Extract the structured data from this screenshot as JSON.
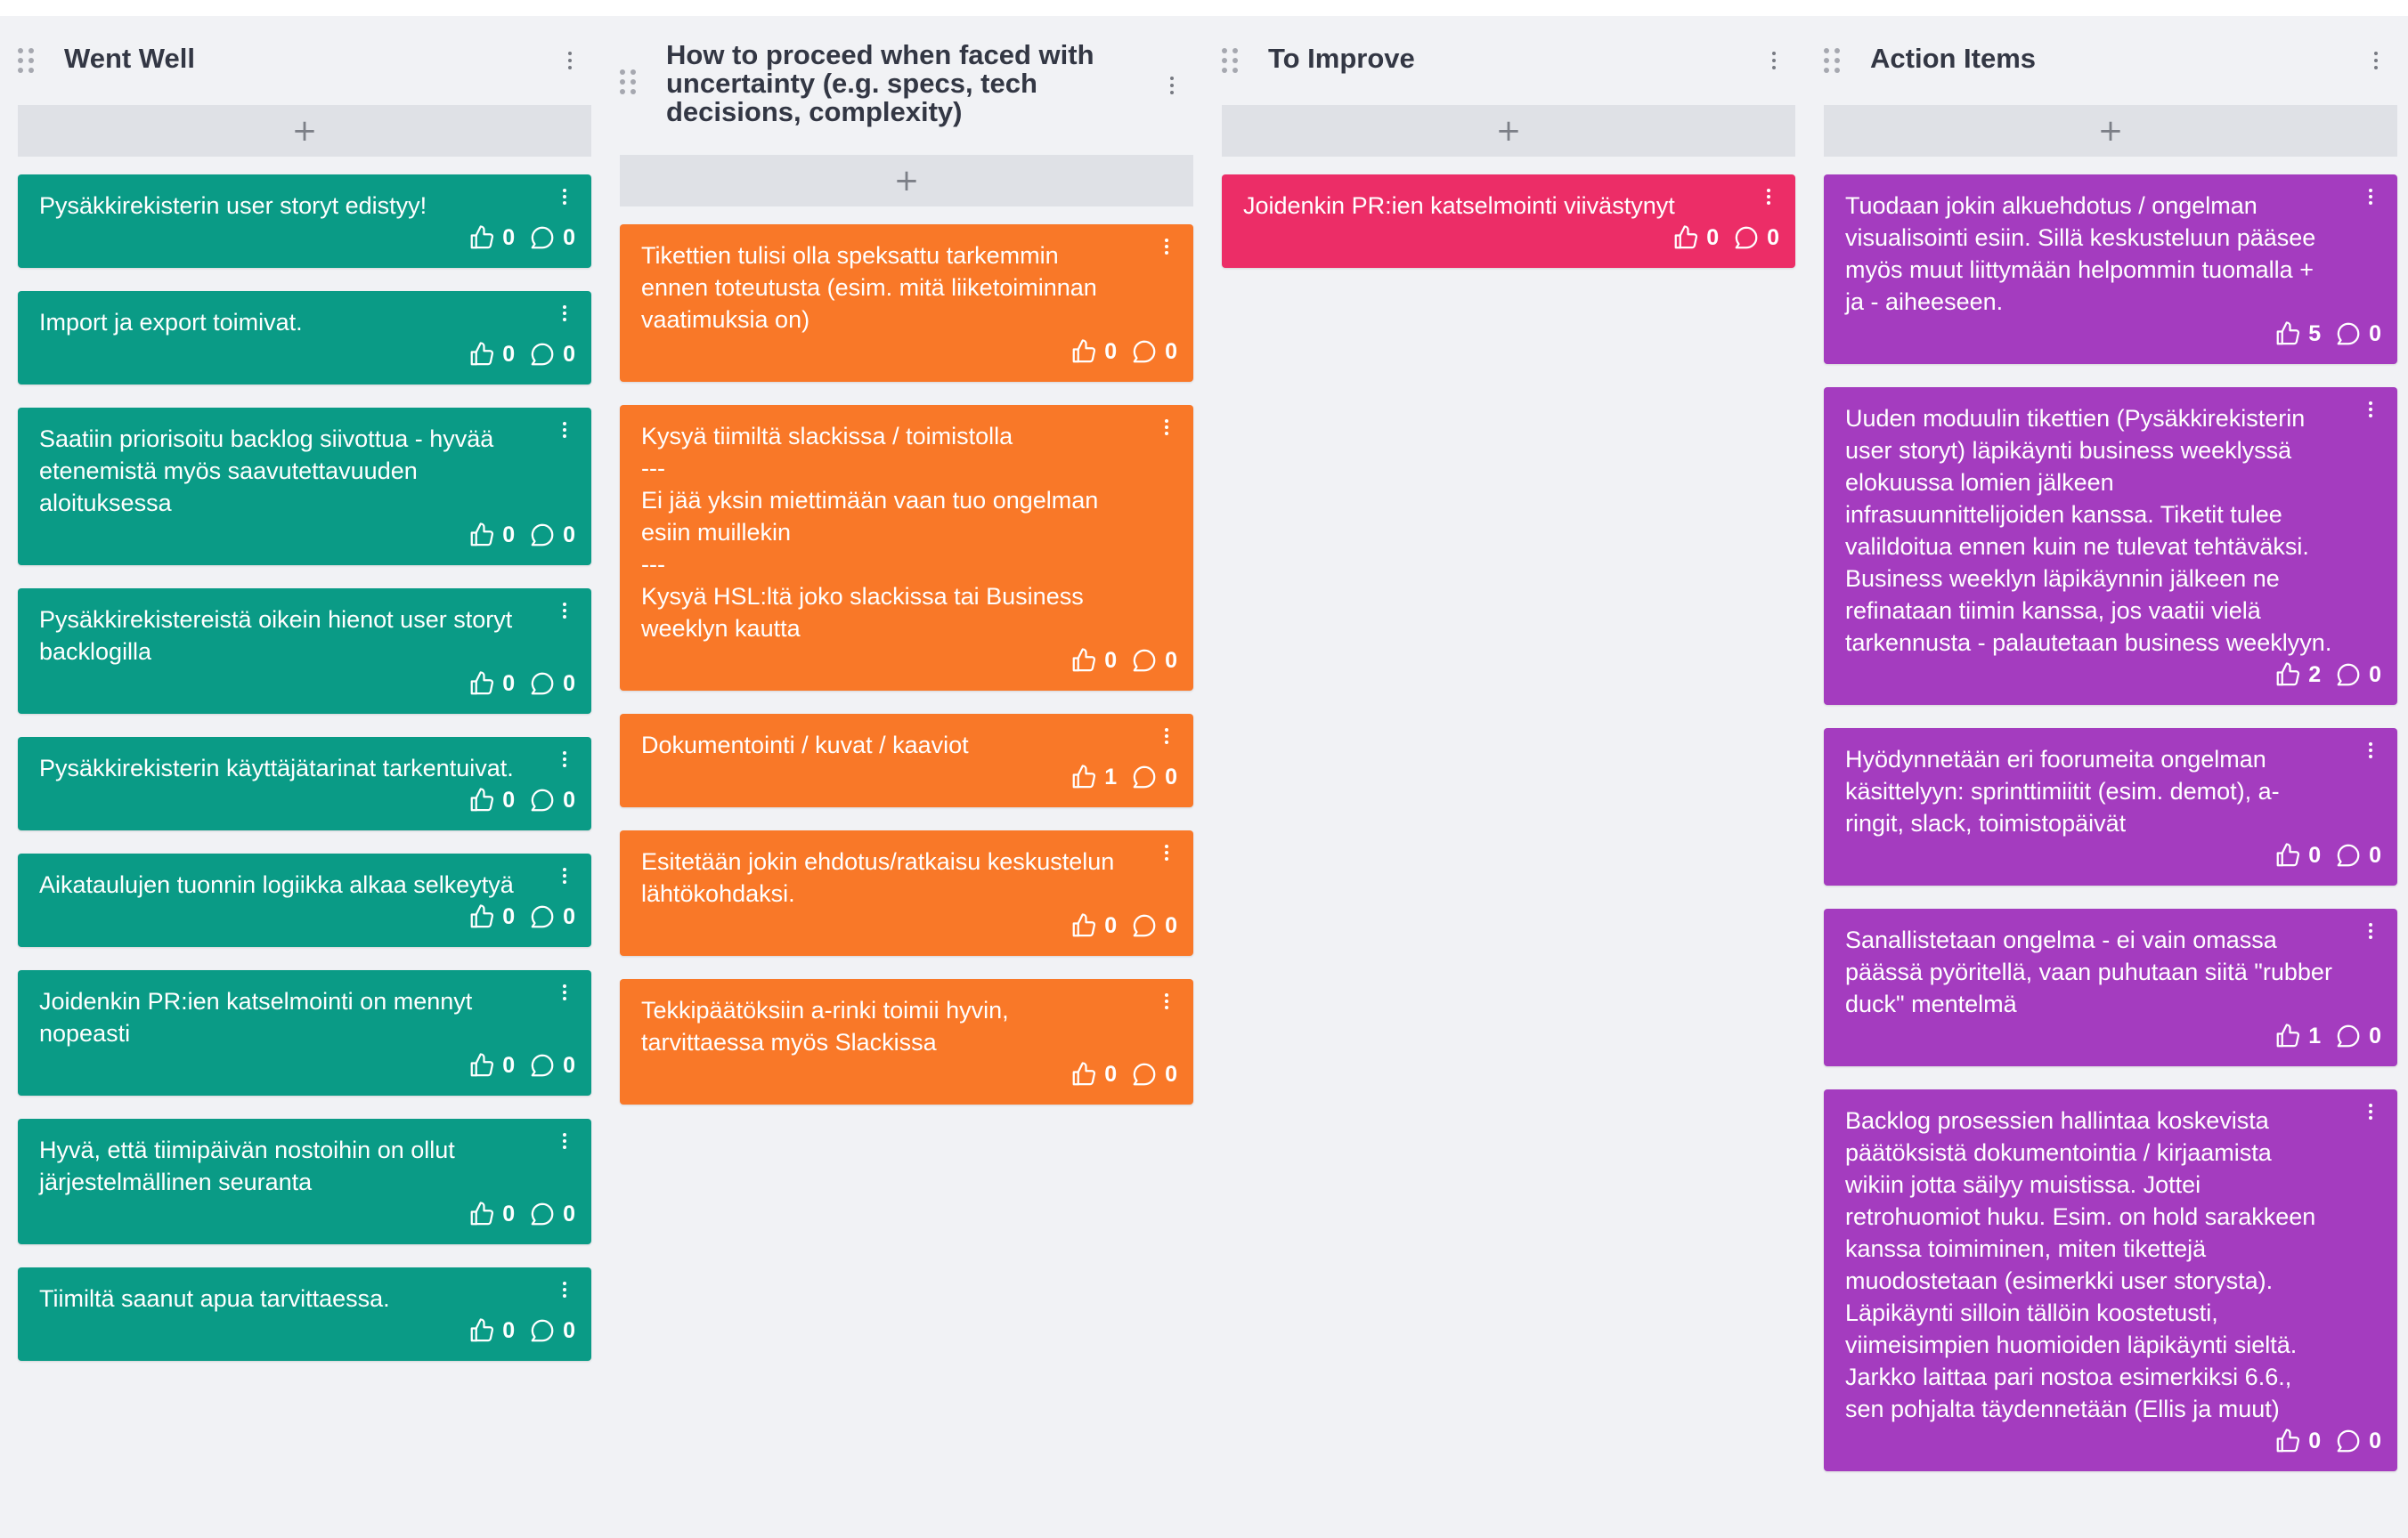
{
  "colors": {
    "went_well": "#0a9b86",
    "proceed": "#f97828",
    "improve": "#ec2d67",
    "action": "#a43cbf",
    "board_bg": "#f1f2f5",
    "add_bar": "#dfe1e6"
  },
  "icons": {
    "drag": "drag-handle-icon",
    "menu": "kebab-menu-icon",
    "add": "plus-icon",
    "vote": "thumbs-up-icon",
    "comment": "comment-bubble-icon"
  },
  "add_symbol": "+",
  "columns": [
    {
      "title": "Went Well",
      "cards": [
        {
          "text": "Pysäkkirekisterin user storyt edistyy!",
          "votes": "0",
          "comments": "0"
        },
        {
          "text": "Import ja export toimivat.",
          "votes": "0",
          "comments": "0"
        },
        {
          "text": "Saatiin priorisoitu backlog siivottua - hyvää etenemistä myös saavutettavuuden aloituksessa",
          "votes": "0",
          "comments": "0"
        },
        {
          "text": "Pysäkkirekistereistä oikein hienot user storyt backlogilla",
          "votes": "0",
          "comments": "0"
        },
        {
          "text": "Pysäkkirekisterin käyttäjätarinat tarkentuivat.",
          "votes": "0",
          "comments": "0"
        },
        {
          "text": "Aikataulujen tuonnin logiikka alkaa selkeytyä",
          "votes": "0",
          "comments": "0"
        },
        {
          "text": "Joidenkin PR:ien katselmointi on mennyt nopeasti",
          "votes": "0",
          "comments": "0"
        },
        {
          "text": "Hyvä, että tiimipäivän nostoihin on ollut järjestelmällinen seuranta",
          "votes": "0",
          "comments": "0"
        },
        {
          "text": "Tiimiltä saanut apua tarvittaessa.",
          "votes": "0",
          "comments": "0"
        }
      ]
    },
    {
      "title": "How to proceed when faced with uncertainty (e.g. specs, tech decisions, complexity)",
      "cards": [
        {
          "text": "Tikettien tulisi olla speksattu tarkemmin ennen toteutusta (esim. mitä liiketoiminnan vaatimuksia on)",
          "votes": "0",
          "comments": "0"
        },
        {
          "text": "Kysyä tiimiltä slackissa / toimistolla\n---\nEi jää yksin miettimään vaan tuo ongelman esiin muillekin\n---\nKysyä HSL:ltä joko slackissa tai Business weeklyn kautta",
          "votes": "0",
          "comments": "0"
        },
        {
          "text": "Dokumentointi / kuvat / kaaviot",
          "votes": "1",
          "comments": "0"
        },
        {
          "text": "Esitetään jokin ehdotus/ratkaisu keskustelun lähtökohdaksi.",
          "votes": "0",
          "comments": "0"
        },
        {
          "text": "Tekkipäätöksiin a-rinki toimii hyvin, tarvittaessa myös Slackissa",
          "votes": "0",
          "comments": "0"
        }
      ]
    },
    {
      "title": "To Improve",
      "cards": [
        {
          "text": "Joidenkin PR:ien katselmointi viivästynyt",
          "votes": "0",
          "comments": "0"
        }
      ]
    },
    {
      "title": "Action Items",
      "cards": [
        {
          "text": "Tuodaan jokin alkuehdotus / ongelman visualisointi esiin. Sillä keskusteluun pääsee myös muut liittymään helpommin tuomalla + ja - aiheeseen.",
          "votes": "5",
          "comments": "0"
        },
        {
          "text": "Uuden moduulin tikettien (Pysäkkirekisterin user storyt) läpikäynti business weeklyssä elokuussa lomien jälkeen infrasuunnittelijoiden kanssa. Tiketit tulee valildoitua ennen kuin ne tulevat tehtäväksi. Business weeklyn läpikäynnin jälkeen ne refinataan tiimin kanssa, jos vaatii vielä tarkennusta - palautetaan business weeklyyn.",
          "votes": "2",
          "comments": "0"
        },
        {
          "text": "Hyödynnetään eri foorumeita ongelman käsittelyyn: sprinttimiitit (esim. demot), a-ringit, slack, toimistopäivät",
          "votes": "0",
          "comments": "0"
        },
        {
          "text": "Sanallistetaan ongelma - ei vain omassa päässä pyöritellä, vaan puhutaan siitä \"rubber duck\" mentelmä",
          "votes": "1",
          "comments": "0"
        },
        {
          "text": "Backlog prosessien hallintaa koskevista päätöksistä dokumentointia / kirjaamista wikiin jotta säilyy muistissa. Jottei retrohuomiot huku. Esim. on hold sarakkeen kanssa toimiminen, miten tikettejä muodostetaan (esimerkki user storysta). Läpikäynti silloin tällöin koostetusti, viimeisimpien huomioiden läpikäynti sieltä. Jarkko laittaa pari nostoa esimerkiksi 6.6., sen pohjalta täydennetään (Ellis ja muut)",
          "votes": "0",
          "comments": "0"
        }
      ]
    }
  ]
}
